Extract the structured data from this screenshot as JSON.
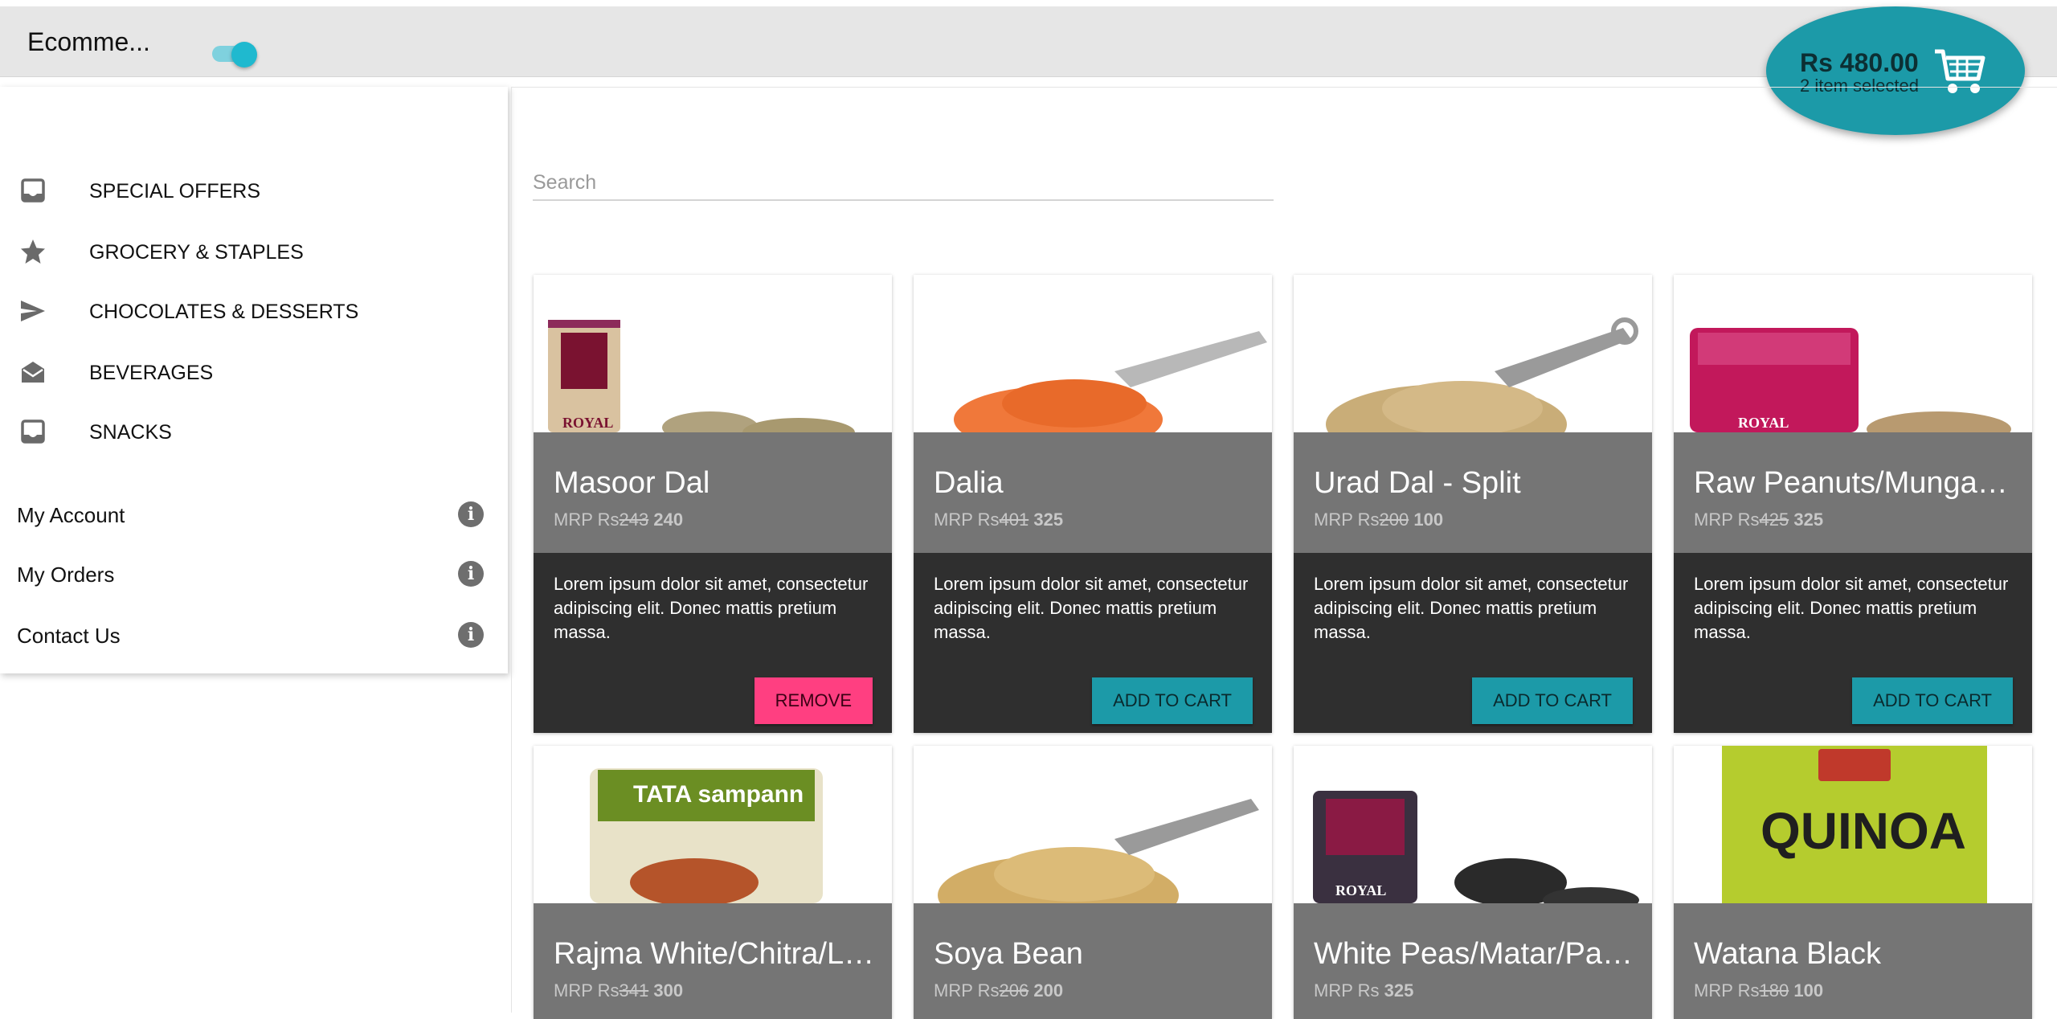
{
  "header": {
    "title": "Ecomme...",
    "dark_mode_toggle": "on"
  },
  "cart": {
    "total": "Rs 480.00",
    "items_selected": "2 item selected",
    "icon": "shopping-cart-icon"
  },
  "sidebar": {
    "categories": [
      {
        "label": "SPECIAL OFFERS",
        "icon": "inbox-icon"
      },
      {
        "label": "GROCERY & STAPLES",
        "icon": "star-icon"
      },
      {
        "label": "CHOCOLATES & DESSERTS",
        "icon": "send-icon"
      },
      {
        "label": "BEVERAGES",
        "icon": "drafts-icon"
      },
      {
        "label": "SNACKS",
        "icon": "inbox-icon"
      }
    ],
    "account": [
      {
        "label": "My Account",
        "icon": "info-icon"
      },
      {
        "label": "My Orders",
        "icon": "info-icon"
      },
      {
        "label": "Contact Us",
        "icon": "info-icon"
      }
    ]
  },
  "search": {
    "placeholder": "Search",
    "value": ""
  },
  "products": [
    {
      "name": "Masoor Dal",
      "mrp_prefix": "MRP Rs",
      "old_price": "243",
      "price": "240",
      "description": "Lorem ipsum dolor sit amet, consectetur adipiscing elit. Donec mattis pretium massa.",
      "button": "REMOVE",
      "in_cart": true
    },
    {
      "name": "Dalia",
      "mrp_prefix": "MRP Rs",
      "old_price": "401",
      "price": "325",
      "description": "Lorem ipsum dolor sit amet, consectetur adipiscing elit. Donec mattis pretium massa.",
      "button": "ADD TO CART",
      "in_cart": false
    },
    {
      "name": "Urad Dal - Split",
      "mrp_prefix": "MRP Rs",
      "old_price": "200",
      "price": "100",
      "description": "Lorem ipsum dolor sit amet, consectetur adipiscing elit. Donec mattis pretium massa.",
      "button": "ADD TO CART",
      "in_cart": false
    },
    {
      "name": "Raw Peanuts/Mungaphali",
      "mrp_prefix": "MRP Rs",
      "old_price": "425",
      "price": "325",
      "description": "Lorem ipsum dolor sit amet, consectetur adipiscing elit. Donec mattis pretium massa.",
      "button": "ADD TO CART",
      "in_cart": false
    },
    {
      "name": "Rajma White/Chitra/Lobia",
      "mrp_prefix": "MRP Rs",
      "old_price": "341",
      "price": "300"
    },
    {
      "name": "Soya Bean",
      "mrp_prefix": "MRP Rs",
      "old_price": "206",
      "price": "200"
    },
    {
      "name": "White Peas/Matar/Pattani",
      "mrp_prefix": "MRP Rs",
      "old_price": "",
      "price": "325"
    },
    {
      "name": "Watana Black",
      "mrp_prefix": "MRP Rs",
      "old_price": "180",
      "price": "100"
    }
  ],
  "product_images": [
    {
      "label": "ROYAL"
    },
    {
      "label": ""
    },
    {
      "label": ""
    },
    {
      "label": "ROYAL"
    },
    {
      "label": "TATA sampann"
    },
    {
      "label": ""
    },
    {
      "label": "ROYAL"
    },
    {
      "label": "QUINOA"
    }
  ]
}
